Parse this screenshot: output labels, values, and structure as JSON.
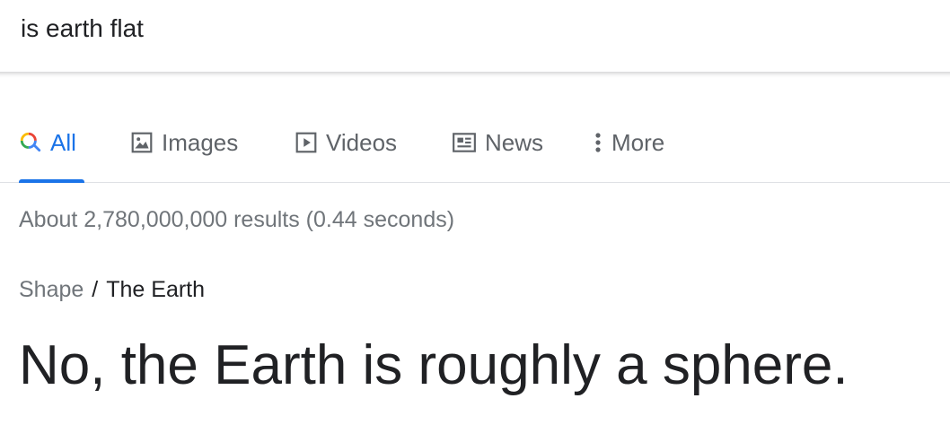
{
  "search": {
    "query": "is earth flat"
  },
  "tabs": [
    {
      "label": "All",
      "icon": "search-icon",
      "active": true
    },
    {
      "label": "Images",
      "icon": "image-icon",
      "active": false
    },
    {
      "label": "Videos",
      "icon": "video-play-icon",
      "active": false
    },
    {
      "label": "News",
      "icon": "newspaper-icon",
      "active": false
    },
    {
      "label": "More",
      "icon": "vertical-dots-icon",
      "active": false
    }
  ],
  "results": {
    "stats": "About 2,780,000,000 results (0.44 seconds)"
  },
  "featured": {
    "breadcrumb_parent": "Shape",
    "breadcrumb_separator": "/",
    "breadcrumb_current": "The Earth",
    "answer": "No, the Earth is roughly a sphere."
  },
  "colors": {
    "accent": "#1a73e8",
    "secondary_text": "#70757a",
    "tab_text": "#5f6368",
    "primary_text": "#202124"
  }
}
